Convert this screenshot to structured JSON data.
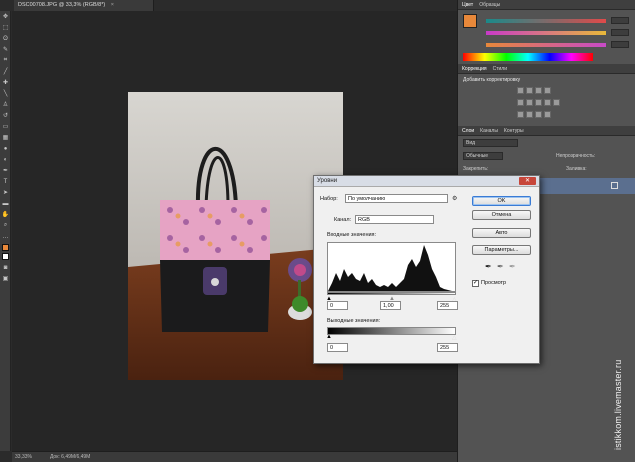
{
  "document_tab": {
    "title": "DSC00708.JPG @ 33,3% (RGB/8*)",
    "close": "×"
  },
  "toolbar": {
    "tools": [
      "move-icon",
      "marquee-icon",
      "lasso-icon",
      "quick-select-icon",
      "crop-icon",
      "eyedropper-icon",
      "healing-icon",
      "brush-icon",
      "stamp-icon",
      "history-brush-icon",
      "eraser-icon",
      "gradient-icon",
      "blur-icon",
      "dodge-icon",
      "pen-icon",
      "type-icon",
      "path-select-icon",
      "shape-icon",
      "hand-icon",
      "zoom-icon"
    ]
  },
  "status": {
    "zoom": "33,33%",
    "doc": "Док: 6,49M/6,49M"
  },
  "colors": {
    "accent_orange": "#e8883a",
    "panel": "#535353"
  },
  "panels": {
    "color_tabs": [
      "Цвет",
      "Образцы"
    ],
    "color_values": {
      "r": "",
      "g": "",
      "b": ""
    },
    "correction_tabs": [
      "Коррекция",
      "Стили"
    ],
    "add_correction": "Добавить корректировку",
    "layers_tabs": [
      "Слои",
      "Каналы",
      "Контуры"
    ],
    "layer_kind": "Вид",
    "blend_mode": "Обычные",
    "opacity_label": "Непрозрачность:",
    "lock_label": "Закрепить:",
    "fill_label": "Заливка:"
  },
  "levels_dialog": {
    "title": "Уровни",
    "preset_label": "Набор:",
    "preset_value": "По умолчанию",
    "channel_label": "Канал:",
    "channel_value": "RGB",
    "input_label": "Входные значения:",
    "input_black": "0",
    "input_gamma": "1,00",
    "input_white": "255",
    "output_label": "Выходные значения:",
    "output_black": "0",
    "output_white": "255",
    "buttons": {
      "ok": "OK",
      "cancel": "Отмена",
      "auto": "Авто",
      "options": "Параметры..."
    },
    "preview_label": "Просмотр",
    "close": "✕"
  },
  "watermark": "istikkom.livemaster.ru"
}
